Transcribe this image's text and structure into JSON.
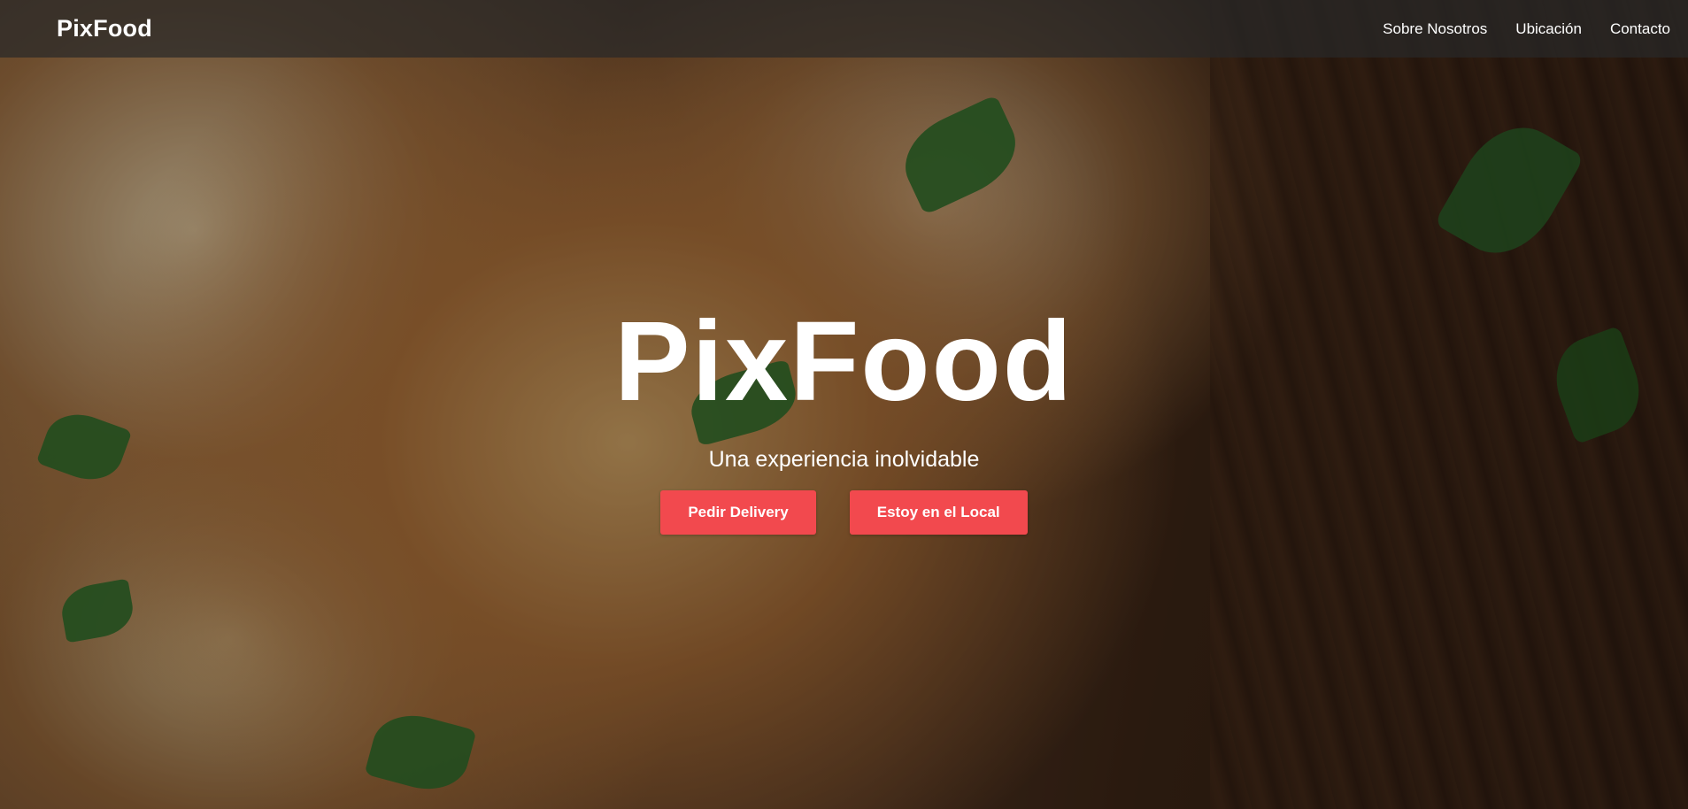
{
  "header": {
    "brand": "PixFood",
    "nav": [
      {
        "label": "Sobre Nosotros"
      },
      {
        "label": "Ubicación"
      },
      {
        "label": "Contacto"
      }
    ]
  },
  "hero": {
    "title": "PixFood",
    "subtitle": "Una experiencia inolvidable",
    "buttons": [
      {
        "label": "Pedir Delivery"
      },
      {
        "label": "Estoy en el Local"
      }
    ],
    "accent_color": "#f2494e"
  }
}
